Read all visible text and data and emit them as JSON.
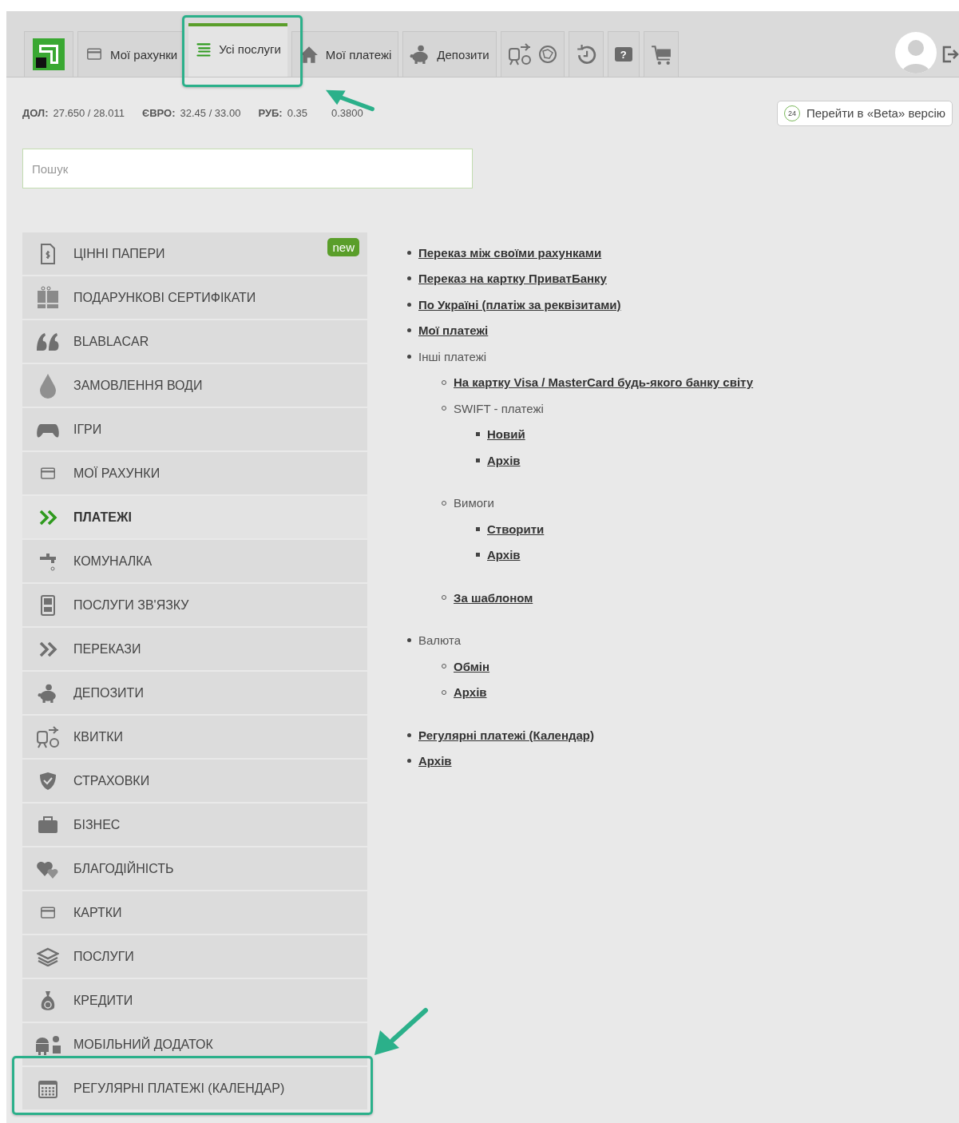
{
  "tabs": [
    {
      "label": "Мої рахунки",
      "selected": false,
      "highlighted": false
    },
    {
      "label": "Усі послуги",
      "selected": true,
      "highlighted": true
    },
    {
      "label": "Мої платежі",
      "selected": false,
      "highlighted": false
    },
    {
      "label": "Депозити",
      "selected": false,
      "highlighted": false
    },
    {
      "selected": false,
      "highlighted": false
    },
    {
      "selected": false,
      "highlighted": false
    },
    {
      "label": "?",
      "selected": false,
      "highlighted": false
    },
    {
      "selected": false,
      "highlighted": false
    }
  ],
  "rates": [
    {
      "currency": "ДОЛ:",
      "value": "27.650 / 28.011"
    },
    {
      "currency": "ЄВРО:",
      "value": "32.45 / 33.00"
    },
    {
      "currency": "РУБ:",
      "value": "0.35",
      "value_end": "0.3800"
    }
  ],
  "beta_button": {
    "badge": "24",
    "label": "Перейти в «Beta» версію"
  },
  "search": {
    "placeholder": "Пошук"
  },
  "menu": [
    {
      "label": "ЦІННІ ПАПЕРИ",
      "badge": "new",
      "selected": false,
      "highlighted": false
    },
    {
      "label": "ПОДАРУНКОВІ СЕРТИФІКАТИ",
      "selected": false,
      "highlighted": false
    },
    {
      "label": "BLABLACAR",
      "selected": false,
      "highlighted": false
    },
    {
      "label": "ЗАМОВЛЕННЯ ВОДИ",
      "selected": false,
      "highlighted": false
    },
    {
      "label": "ІГРИ",
      "selected": false,
      "highlighted": false
    },
    {
      "label": "МОЇ РАХУНКИ",
      "selected": false,
      "highlighted": false
    },
    {
      "label": "ПЛАТЕЖІ",
      "selected": true,
      "highlighted": false
    },
    {
      "label": "КОМУНАЛКА",
      "selected": false,
      "highlighted": false
    },
    {
      "label": "ПОСЛУГИ ЗВ'ЯЗКУ",
      "selected": false,
      "highlighted": false
    },
    {
      "label": "ПЕРЕКАЗИ",
      "selected": false,
      "highlighted": false
    },
    {
      "label": "ДЕПОЗИТИ",
      "selected": false,
      "highlighted": false
    },
    {
      "label": "КВИТКИ",
      "selected": false,
      "highlighted": false
    },
    {
      "label": "СТРАХОВКИ",
      "selected": false,
      "highlighted": false
    },
    {
      "label": "БІЗНЕС",
      "selected": false,
      "highlighted": false
    },
    {
      "label": "БЛАГОДІЙНІСТЬ",
      "selected": false,
      "highlighted": false
    },
    {
      "label": "КАРТКИ",
      "selected": false,
      "highlighted": false
    },
    {
      "label": "ПОСЛУГИ",
      "selected": false,
      "highlighted": false
    },
    {
      "label": "КРЕДИТИ",
      "selected": false,
      "highlighted": false
    },
    {
      "label": "МОБІЛЬНИЙ ДОДАТОК",
      "selected": false,
      "highlighted": false
    },
    {
      "label": "РЕГУЛЯРНІ ПЛАТЕЖІ (КАЛЕНДАР)",
      "selected": false,
      "highlighted": true
    }
  ],
  "links": [
    {
      "text": "Переказ між своїми рахунками",
      "link": true
    },
    {
      "text": "Переказ на картку ПриватБанку",
      "link": true
    },
    {
      "text": "По Україні (платіж за реквізитами)",
      "link": true
    },
    {
      "text": "Мої платежі",
      "link": true
    },
    {
      "text": "Інші платежі",
      "link": false,
      "children": [
        {
          "text": "На картку Visa / MasterCard будь-якого банку світу",
          "link": true
        },
        {
          "text": "SWIFT - платежі",
          "link": false,
          "children": [
            {
              "text": "Новий",
              "link": true
            },
            {
              "text": "Архів",
              "link": true
            }
          ]
        },
        {
          "text": "Вимоги",
          "link": false,
          "children": [
            {
              "text": "Створити",
              "link": true
            },
            {
              "text": "Архів",
              "link": true
            }
          ]
        },
        {
          "text": "За шаблоном",
          "link": true
        }
      ]
    },
    {
      "text": "Валюта",
      "link": false,
      "children": [
        {
          "text": "Обмін",
          "link": true
        },
        {
          "text": "Архів",
          "link": true
        }
      ]
    },
    {
      "text": "Регулярні платежі (Календар)",
      "link": true
    },
    {
      "text": "Архів",
      "link": true
    }
  ]
}
